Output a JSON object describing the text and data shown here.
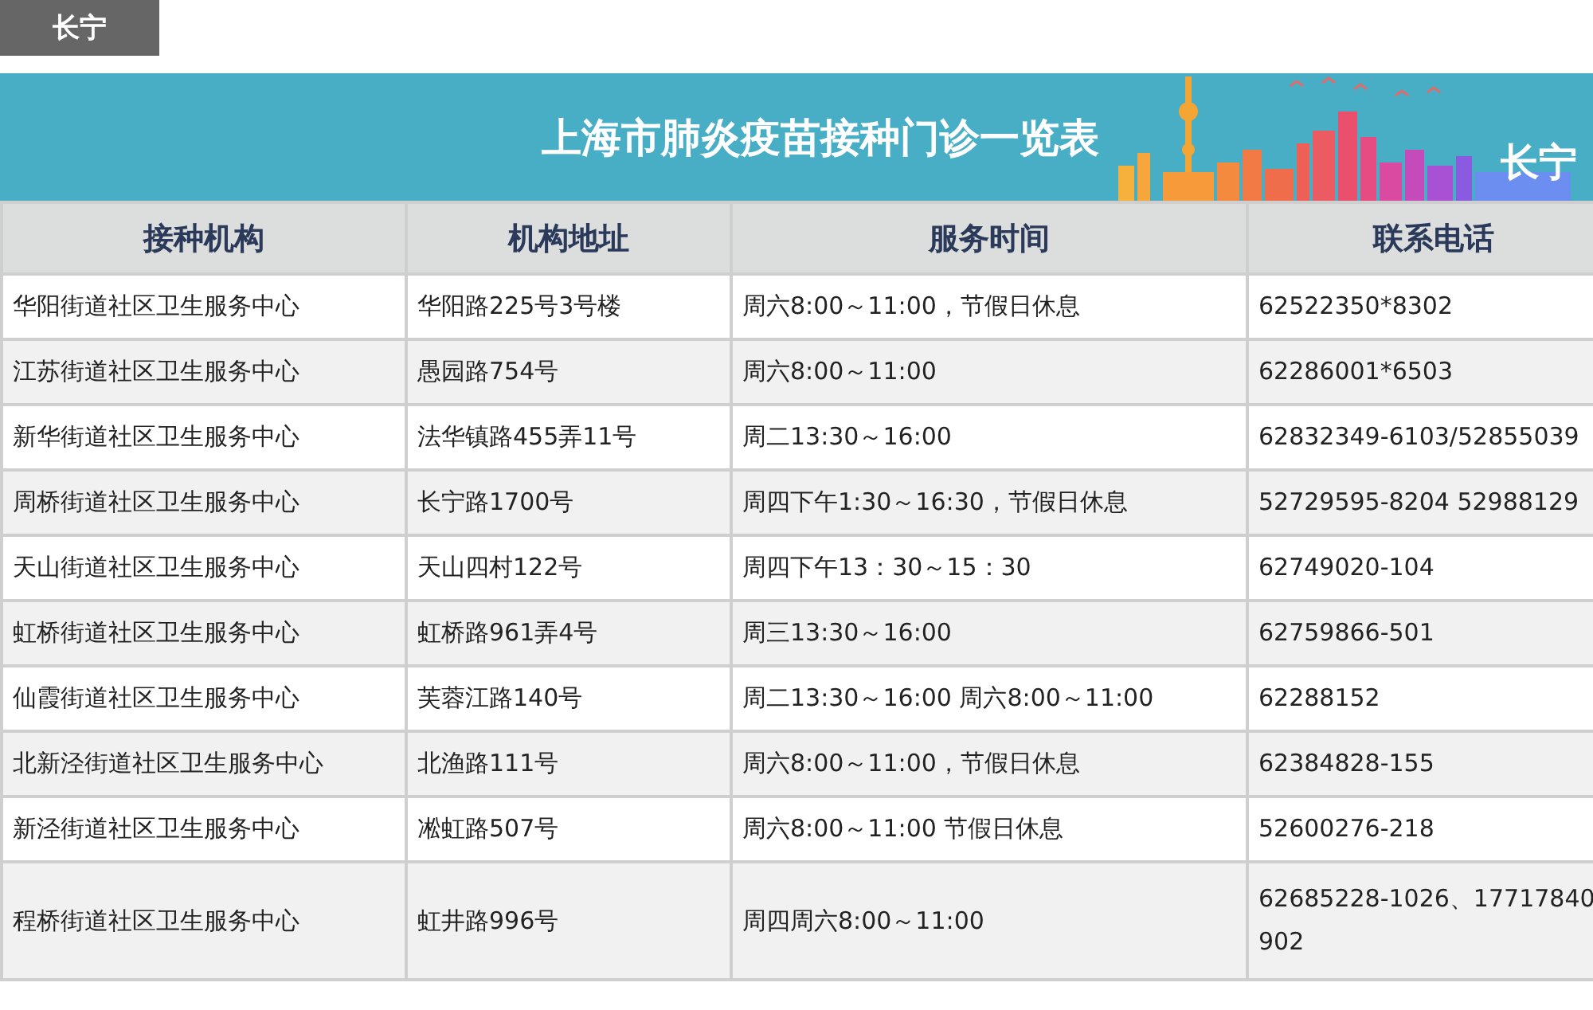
{
  "tab": {
    "label": "长宁"
  },
  "banner": {
    "title": "上海市肺炎疫苗接种门诊一览表",
    "district": "长宁"
  },
  "table": {
    "columns": [
      "接种机构",
      "机构地址",
      "服务时间",
      "联系电话"
    ],
    "rows": [
      [
        "华阳街道社区卫生服务中心",
        "华阳路225号3号楼",
        "周六8:00～11:00，节假日休息",
        "62522350*8302"
      ],
      [
        "江苏街道社区卫生服务中心",
        "愚园路754号",
        "周六8:00～11:00",
        "62286001*6503"
      ],
      [
        "新华街道社区卫生服务中心",
        "法华镇路455弄11号",
        "周二13:30～16:00",
        "62832349-6103/52855039"
      ],
      [
        "周桥街道社区卫生服务中心",
        "长宁路1700号",
        "周四下午1:30～16:30，节假日休息",
        "52729595-8204 52988129"
      ],
      [
        "天山街道社区卫生服务中心",
        "天山四村122号",
        "周四下午13：30～15：30",
        "62749020-104"
      ],
      [
        "虹桥街道社区卫生服务中心",
        "虹桥路961弄4号",
        "周三13:30～16:00",
        "62759866-501"
      ],
      [
        "仙霞街道社区卫生服务中心",
        "芙蓉江路140号",
        "周二13:30～16:00 周六8:00～11:00",
        "62288152"
      ],
      [
        "北新泾街道社区卫生服务中心",
        "北渔路111号",
        "周六8:00～11:00，节假日休息",
        "62384828-155"
      ],
      [
        "新泾街道社区卫生服务中心",
        "凇虹路507号",
        "周六8:00～11:00 节假日休息",
        "52600276-218"
      ],
      [
        "程桥街道社区卫生服务中心",
        "虹井路996号",
        "周四周六8:00～11:00",
        "62685228-1026、17717840902"
      ]
    ]
  }
}
